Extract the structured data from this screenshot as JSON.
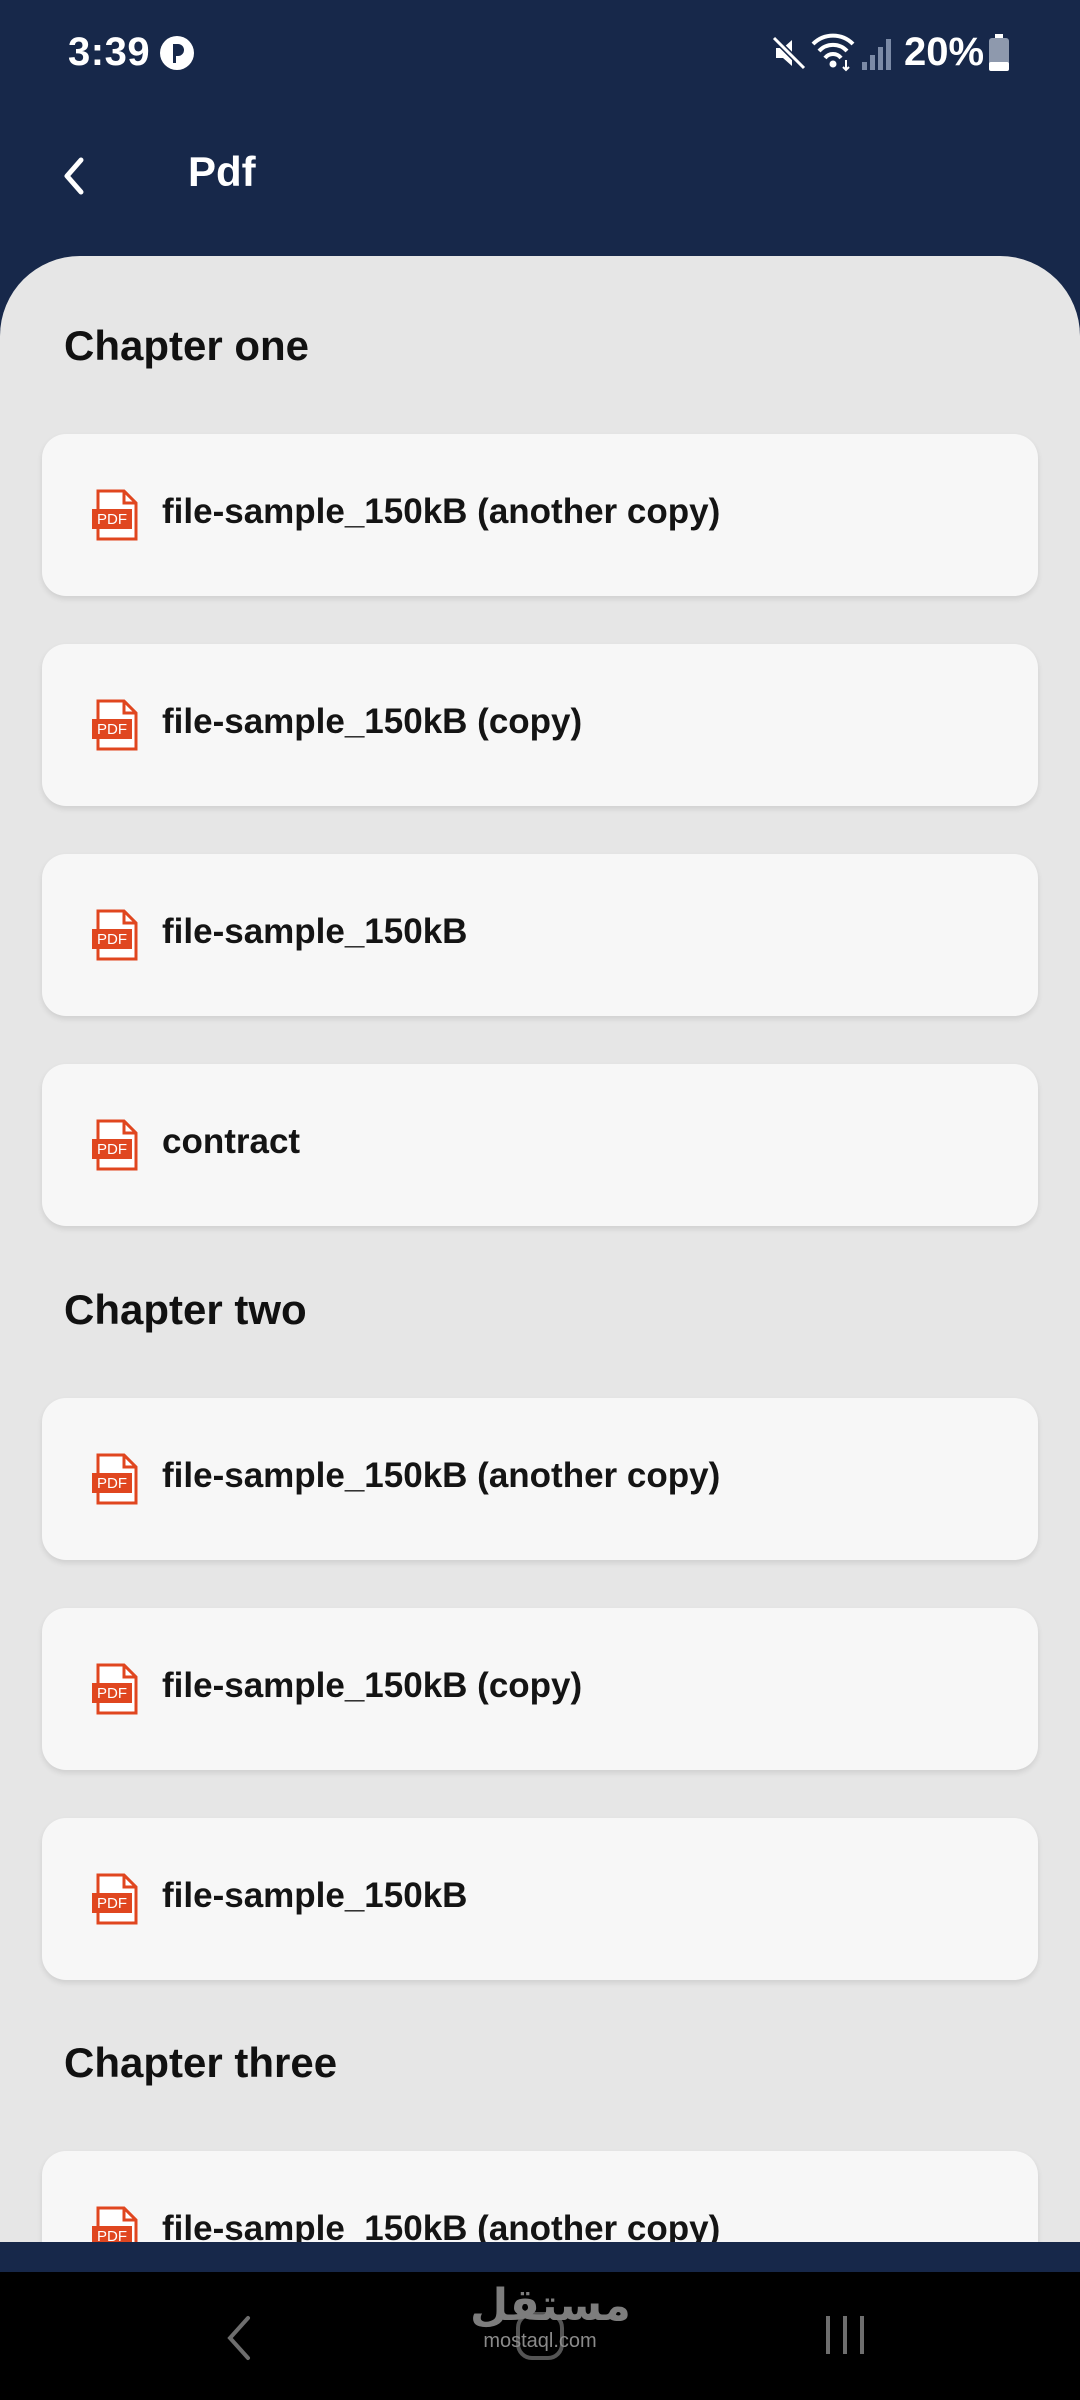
{
  "status_bar": {
    "time": "3:39",
    "battery": "20%",
    "icons": [
      "app-notification-icon",
      "mute-icon",
      "wifi-icon",
      "signal-icon",
      "battery-icon"
    ]
  },
  "app_bar": {
    "title": "Pdf",
    "back_icon": "chevron-left-icon"
  },
  "colors": {
    "header_bg": "#17284a",
    "sheet_bg": "#e6e6e6",
    "card_bg": "#f7f7f7",
    "pdf_icon": "#e0461f"
  },
  "chapters": [
    {
      "title": "Chapter one",
      "files": [
        "file-sample_150kB (another copy)",
        "file-sample_150kB (copy)",
        "file-sample_150kB",
        "contract"
      ]
    },
    {
      "title": "Chapter two",
      "files": [
        "file-sample_150kB (another copy)",
        "file-sample_150kB (copy)",
        "file-sample_150kB"
      ]
    },
    {
      "title": "Chapter three",
      "files": [
        "file-sample_150kB (another copy)"
      ]
    }
  ],
  "watermark": {
    "arabic": "مستقل",
    "latin": "mostaql.com"
  }
}
